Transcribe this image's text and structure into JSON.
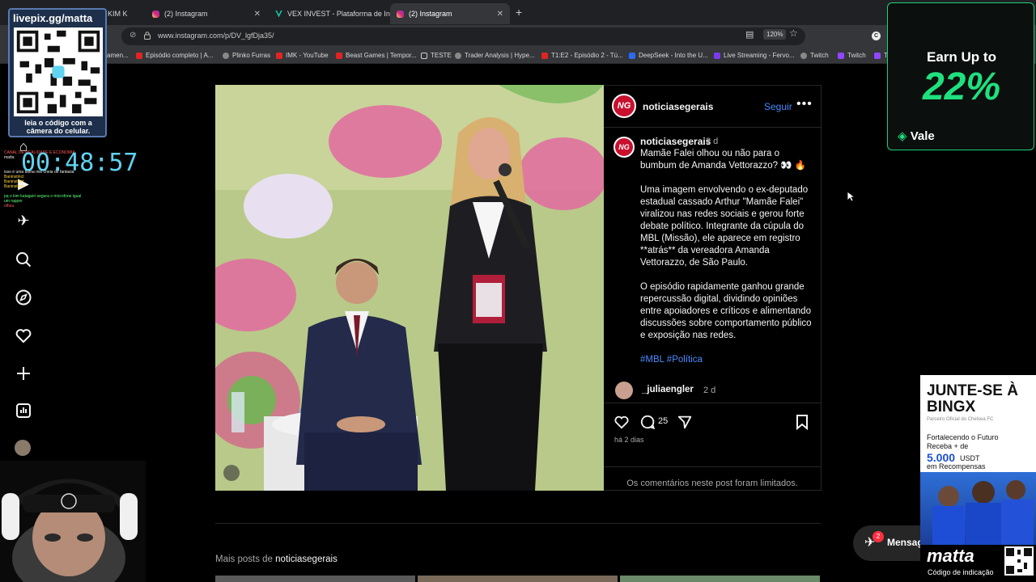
{
  "tabs": [
    {
      "label": "DE KIM K",
      "icon": "tab-favicon"
    },
    {
      "label": "(2) Instagram",
      "icon": "instagram-icon"
    },
    {
      "label": "VEX INVEST - Plataforma de Inv",
      "icon": "vex-icon"
    },
    {
      "label": "(2) Instagram",
      "icon": "instagram-icon",
      "active": true
    }
  ],
  "address": {
    "url": "www.instagram.com/p/DV_lgfDja35/",
    "zoom": "120%"
  },
  "bookmarks": [
    "amen...",
    "Episódio completo | A...",
    "Plinko Furras",
    "IMK - YouTube",
    "Beast Games | Tempor...",
    "TESTE",
    "Trader Analysis | Hype...",
    "T1:E2 - Episódio 2 - Tú...",
    "DeepSeek - Into the U...",
    "Live Streaming - Fervo...",
    "Twitch",
    "Twitch",
    "Tv"
  ],
  "post": {
    "author": "noticiasegerais",
    "logo_text": "NG",
    "follow_label": "Seguir",
    "caption_time": "2 d",
    "caption_title": "Mamãe Falei olhou ou não para o bumbum de Amanda Vettorazzo? 👀 🔥",
    "caption_p1": "Uma imagem envolvendo o ex-deputado estadual cassado Arthur \"Mamãe Falei\" viralizou nas redes sociais e gerou forte debate político. Integrante da cúpula do MBL (Missão), ele aparece em registro **atrás** da vereadora Amanda Vettorazzo, de São Paulo.",
    "caption_p2": "O episódio rapidamente ganhou grande repercussão digital, dividindo opiniões entre apoiadores e críticos e alimentando discussões sobre comportamento público e exposição nas redes.",
    "hashtags": "#MBL #Política",
    "comment_user": "_juliaengler",
    "comment_time": "2 d",
    "comment_count": "25",
    "posted_ago": "há 2 dias",
    "comments_limited": "Os comentários neste post foram limitados.",
    "more_posts_prefix": "Mais posts de",
    "more_posts_author": "noticiasegerais"
  },
  "messages": {
    "label": "Mensag",
    "badge": "2"
  },
  "overlay": {
    "qr_title": "livepix.gg/matta",
    "qr_caption": "leia o código com a câmera do celular.",
    "timer": "00:48:57",
    "promo_earn": "Earn Up to",
    "promo_pct": "22%",
    "promo_brand": "Vale",
    "bingx_head": "JUNTE-SE À BINGX",
    "bingx_sub": "Parceiro Oficial do Chelsea FC",
    "bingx_l1": "Fortalecendo o Futuro",
    "bingx_l2": "Receba + de",
    "bingx_amount": "5.000",
    "bingx_unit": "USDT",
    "bingx_l3": "em Recompensas",
    "matta": "matta",
    "matta_cap": "Código de indicação"
  },
  "colors": {
    "accent": "#4a8bff",
    "promo_green": "#1fe07f",
    "timer": "#5fd3f0"
  }
}
